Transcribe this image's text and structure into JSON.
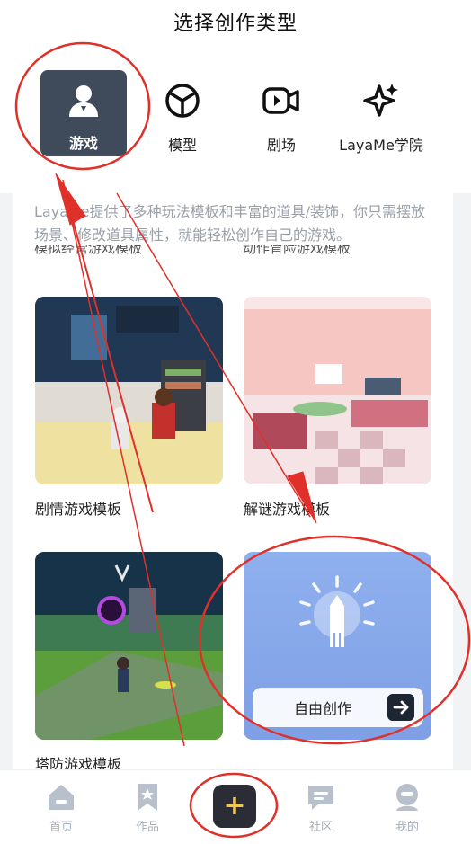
{
  "header": {
    "title": "选择创作类型"
  },
  "categories": [
    {
      "label": "游戏",
      "icon": "user-icon",
      "active": true
    },
    {
      "label": "模型",
      "icon": "cube-icon",
      "active": false
    },
    {
      "label": "剧场",
      "icon": "video-camera-icon",
      "active": false
    },
    {
      "label": "LayaMe学院",
      "icon": "sparkle-icon",
      "active": false
    }
  ],
  "content": {
    "description": "LayaMe提供了多种玩法模板和丰富的道具/装饰，你只需摆放场景、修改道具属性，就能轻松创作自己的游戏。",
    "partially_hidden_labels": [
      "模拟经营游戏模板",
      "动作冒险游戏模板"
    ],
    "templates": [
      {
        "label": "剧情游戏模板"
      },
      {
        "label": "解谜游戏模板"
      },
      {
        "label": "塔防游戏模板"
      }
    ],
    "free_create": {
      "label": "自由创作"
    }
  },
  "bottom_nav": {
    "items": [
      {
        "label": "首页",
        "icon": "home-icon"
      },
      {
        "label": "作品",
        "icon": "bookmark-star-icon"
      },
      {
        "label": "社区",
        "icon": "chat-icon"
      },
      {
        "label": "我的",
        "icon": "profile-icon"
      }
    ],
    "center_button": {
      "glyph": "+",
      "icon": "plus-icon"
    }
  },
  "colors": {
    "active_category_bg": "#3f4a5a",
    "annotation_red": "#e0302a",
    "plus_button_bg": "#2a2d35",
    "plus_glyph": "#f6c744",
    "nav_inactive": "#a5adba",
    "free_create_bg": "#8aa9ec"
  }
}
